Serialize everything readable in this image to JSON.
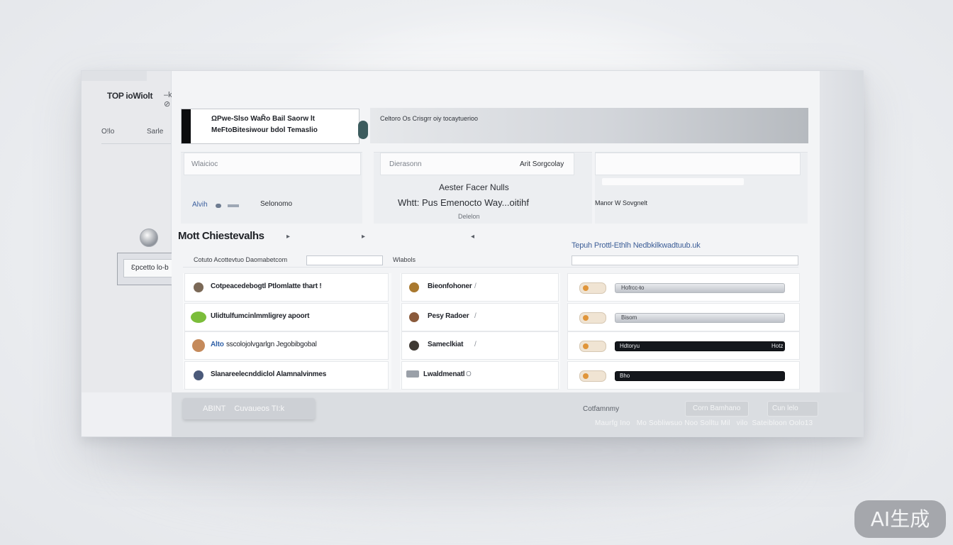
{
  "window": {
    "brand": "TOP ioWiolt",
    "brand_suffix": "–⁠kḁḁ ⊘",
    "sidebar": {
      "nav_left": "Oǃlo",
      "nav_right": "Sarle"
    },
    "popup_label": "Ԑpcetto lo-b"
  },
  "header": {
    "card_line1": "ΩPwe-Slso WaŘo Bail Saorw lt",
    "card_line2": "MeFtoBitesiwour bdol   Temaslio",
    "banner_text": "Celtoro Os Crisgrr oiy tocaytuerioo"
  },
  "panels": {
    "p1": {
      "field_placeholder": "Wlaicioc",
      "link": "Alvih",
      "label": "Selonomo"
    },
    "p2": {
      "field_placeholder": "Dierasonn",
      "field_value": "Arit Sorgcolay",
      "line1": "Aester Facer Nulls",
      "line2": "Whtt: Pus Emenocto Way...oitihf",
      "line3": "Delelon"
    },
    "p3": {
      "label": "Manor  W Sovgnelt"
    }
  },
  "section": {
    "title": "Mott Chiestevalhs",
    "blue_label": "Tepuh Prottl-Ethlh Nedbkilkwadtuub.uk",
    "header_col1": "Cotuto Acottevtuo Daomabetcom",
    "header_col2": "Wlabols"
  },
  "rows": {
    "col1": [
      {
        "text": "Cotpeacedebogtl Ptlomlatte thart !"
      },
      {
        "text": "Ulidtulfumcinlmmligrey apoort"
      },
      {
        "text": "Alto",
        "text_rest": "sscolojolvgarlgn Jegobibgobal"
      },
      {
        "text": "Slanareelecnddiclol Alamnalvinmes"
      }
    ],
    "col2": [
      {
        "text": "Bieonfohoner",
        "meta": "/"
      },
      {
        "text": "Pesy Radoer",
        "meta": "/"
      },
      {
        "text": "Sameclkiat",
        "meta": "/"
      },
      {
        "text": "Lwaldmenatl",
        "meta": "O"
      }
    ],
    "col3": [
      {
        "label_left": "Hofrcc-ŧo",
        "label_right": "",
        "style": "light"
      },
      {
        "label_left": "Bisom",
        "label_right": "",
        "style": "light"
      },
      {
        "label_left": "Hdtoryu",
        "label_right": "Hotz",
        "style": "dark"
      },
      {
        "label_left": "Bho",
        "label_right": "",
        "style": "dark"
      }
    ]
  },
  "footer": {
    "left_button": "ABINT    Cuvaueos TI:k",
    "status": "Cotfamnmy",
    "button_a": "Corn Bamhano",
    "button_b": "Cun lelo",
    "line": "Maurfg Ino   Mo Sobliwsuo Noo Solltu Mil   vilo  Sateibloon Oolo13"
  },
  "watermark": "AI生成",
  "colors": {
    "accent_blue": "#3e5f98",
    "dark_track": "#14171c",
    "toggle_orange": "#e0953a"
  }
}
